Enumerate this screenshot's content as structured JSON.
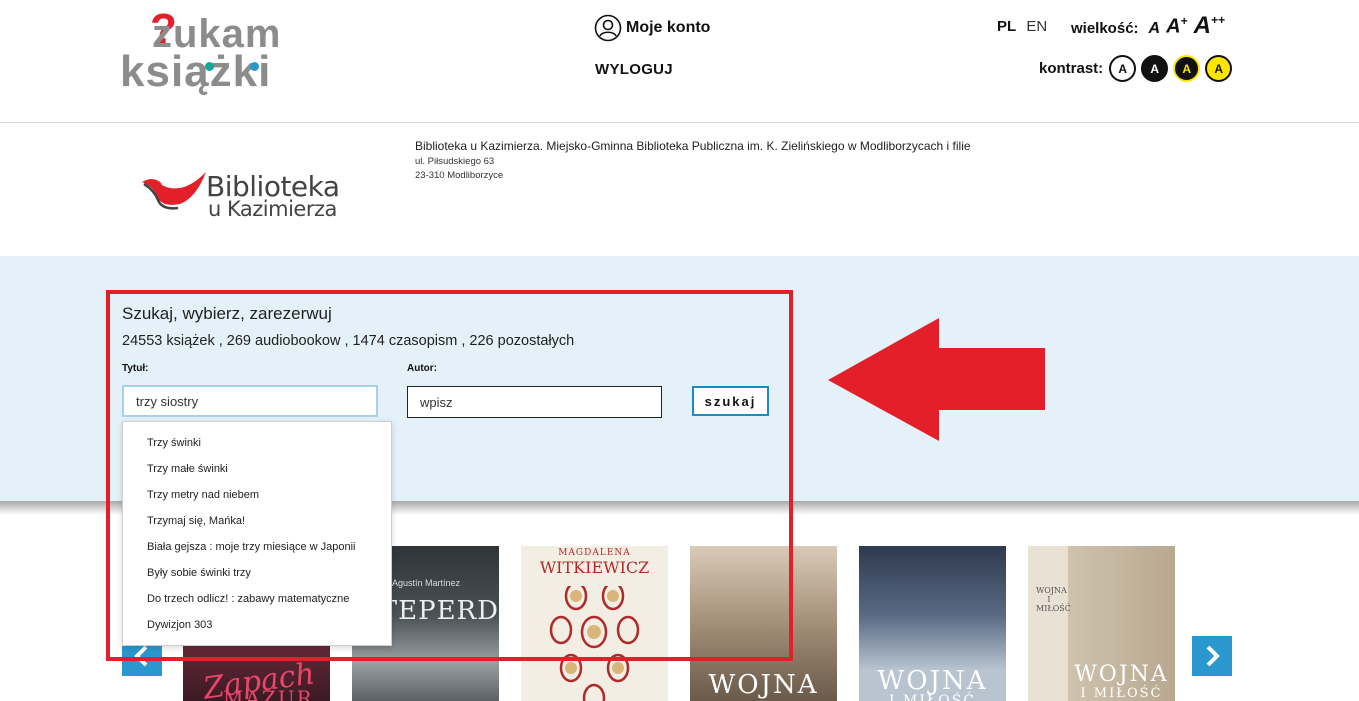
{
  "header": {
    "logo_top": "zukam",
    "logo_bottom": "książki",
    "account_label": "Moje konto",
    "logout_label": "WYLOGUJ",
    "lang_pl": "PL",
    "lang_en": "EN",
    "size_label": "wielkość:",
    "size_a1": "A",
    "size_a2": "A",
    "size_a2_sup": "+",
    "size_a3": "A",
    "size_a3_sup": "++",
    "contrast_label": "kontrast:",
    "contrast_options": [
      "A",
      "A",
      "A",
      "A"
    ]
  },
  "library": {
    "logo_line1": "Biblioteka",
    "logo_line2": "u Kazimierza",
    "name": "Biblioteka u Kazimierza. Miejsko-Gminna Biblioteka Publiczna im. K. Zielińskiego w Modliborzycach i filie",
    "street": "ul. Piłsudskiego 63",
    "city": "23-310 Modliborzyce"
  },
  "search": {
    "title": "Szukaj, wybierz, zarezerwuj",
    "counts": "24553 książek , 269 audiobookow , 1474 czasopism , 226 pozostałych",
    "title_label": "Tytuł:",
    "title_value": "trzy siostry",
    "author_label": "Autor:",
    "author_placeholder": "wpisz",
    "search_button": "szukaj",
    "suggestions": [
      "Trzy świnki",
      "Trzy małe świnki",
      "Trzy metry nad niebem",
      "Trzymaj się, Mańka!",
      "Biała gejsza : moje trzy miesiące w Japonii",
      "Były sobie świnki trzy",
      "Do trzech odlicz! : zabawy matematyczne",
      "Dywizjon 303"
    ]
  },
  "books": {
    "covers": [
      {
        "text": "Zapach",
        "text2": "MAZUR"
      },
      {
        "author": "Agustín Martínez",
        "text": "NTEPERDIDO"
      },
      {
        "author": "MAGDALENA",
        "text": "WITKIEWICZ"
      },
      {
        "text": "WOJNA"
      },
      {
        "text": "WOJNA",
        "text2": "I MIŁOŚĆ"
      },
      {
        "text": "WOJNA",
        "text2": "I MIŁOŚĆ",
        "spine": "WOJNA I MIŁOŚĆ"
      }
    ]
  },
  "colors": {
    "accent_blue": "#2a98cf",
    "search_bg": "#e4f1f9",
    "annotation_red": "#e3202a",
    "logo_gray": "#8c8c8c"
  }
}
